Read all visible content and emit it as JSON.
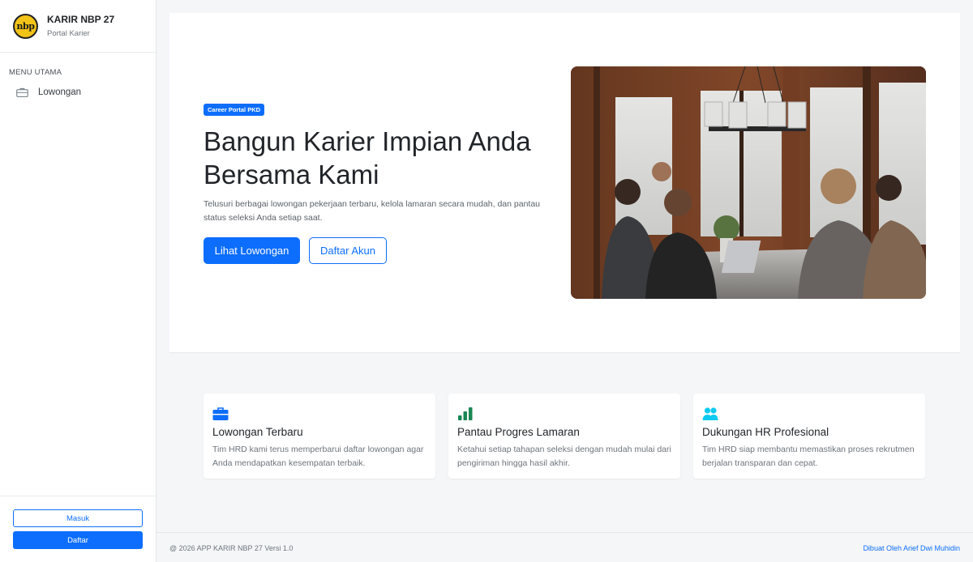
{
  "sidebar": {
    "logo_text": "nbp",
    "brand_name": "KARIR NBP 27",
    "brand_sub": "Portal Karier",
    "menu_heading": "MENU UTAMA",
    "items": [
      {
        "label": "Lowongan",
        "icon": "briefcase-icon"
      }
    ],
    "login_label": "Masuk",
    "register_label": "Daftar"
  },
  "hero": {
    "badge": "Career Portal PKD",
    "title": "Bangun Karier Impian Anda Bersama Kami",
    "description": "Telusuri berbagai lowongan pekerjaan terbaru, kelola lamaran secara mudah, dan pantau status seleksi Anda setiap saat.",
    "primary_button": "Lihat Lowongan",
    "secondary_button": "Daftar Akun"
  },
  "features": [
    {
      "icon": "briefcase-icon",
      "title": "Lowongan Terbaru",
      "text": "Tim HRD kami terus memperbarui daftar lowongan agar Anda mendapatkan kesempatan terbaik."
    },
    {
      "icon": "bar-chart-icon",
      "title": "Pantau Progres Lamaran",
      "text": "Ketahui setiap tahapan seleksi dengan mudah mulai dari pengiriman hingga hasil akhir."
    },
    {
      "icon": "people-icon",
      "title": "Dukungan HR Profesional",
      "text": "Tim HRD siap membantu memastikan proses rekrutmen berjalan transparan dan cepat."
    }
  ],
  "footer": {
    "copyright": "@ 2026 APP KARIR NBP 27 Versi 1.0",
    "credit": "Dibuat Oleh Arief Dwi Muhidin"
  },
  "colors": {
    "primary": "#0d6efd",
    "success": "#198754",
    "info": "#0dcaf0",
    "logo": "#f3c318"
  }
}
